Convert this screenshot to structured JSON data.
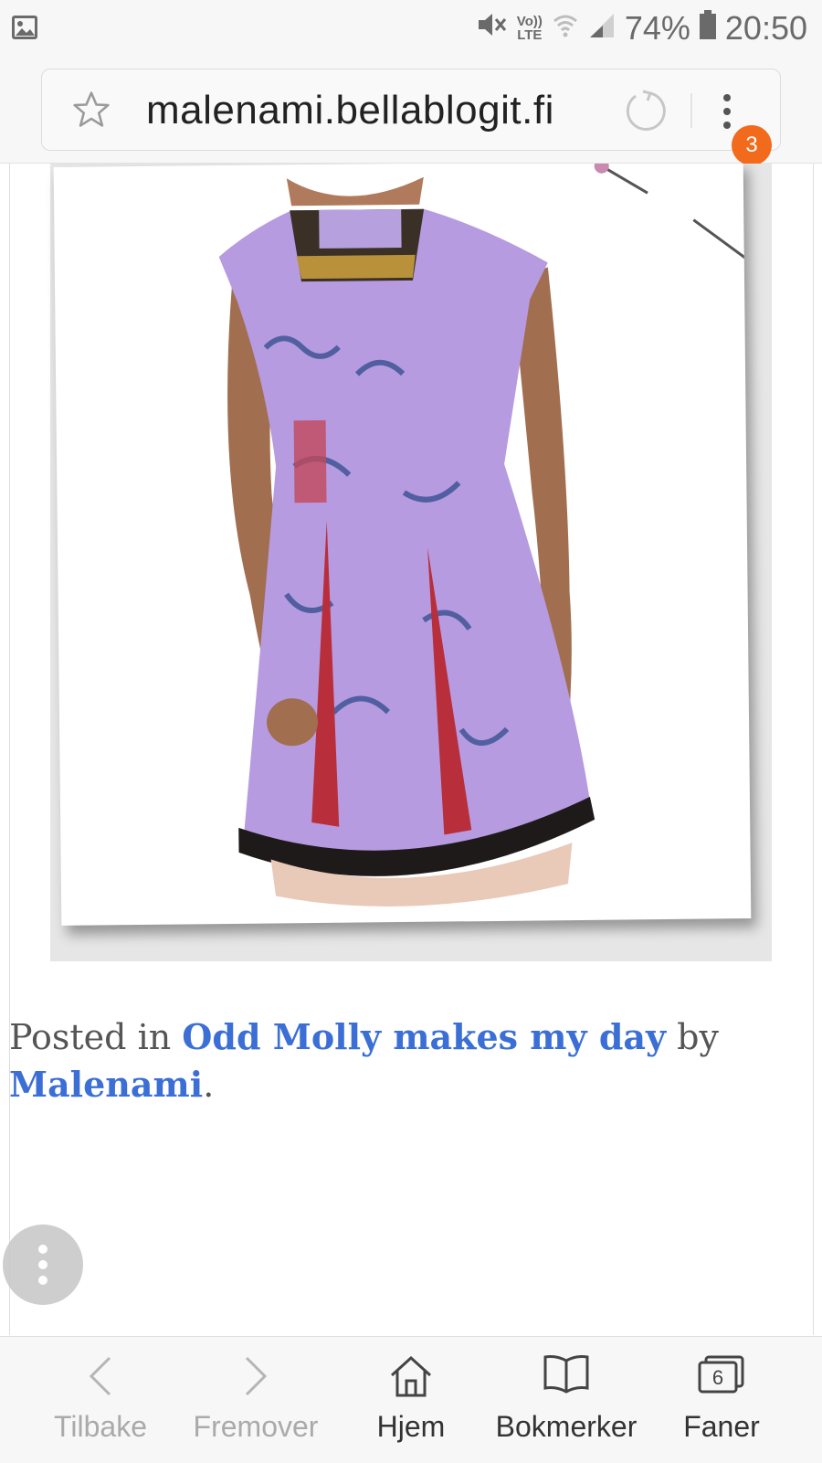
{
  "status_bar": {
    "icons": [
      "gallery-icon",
      "mute-icon",
      "volte-icon",
      "wifi-icon",
      "signal-icon",
      "battery-icon"
    ],
    "volte_top": "Vo))",
    "volte_bottom": "LTE",
    "battery": "74%",
    "time": "20:50"
  },
  "browser": {
    "url": "malenami.bellablogit.fi",
    "tabs_badge": "3"
  },
  "post": {
    "image_alt": "Purple patterned dress with lace hem",
    "caption_prefix": "Posted in ",
    "category_link": "Odd Molly makes my day",
    "by_text": " by",
    "author_link": "Malenami",
    "period": "."
  },
  "toolbar": {
    "back": "Tilbake",
    "forward": "Fremover",
    "home": "Hjem",
    "bookmarks": "Bokmerker",
    "tabs": "Faner",
    "tabs_count": "6"
  },
  "colors": {
    "link": "#3b6fd6",
    "badge": "#f26a1b",
    "dress": "#b79be0"
  }
}
